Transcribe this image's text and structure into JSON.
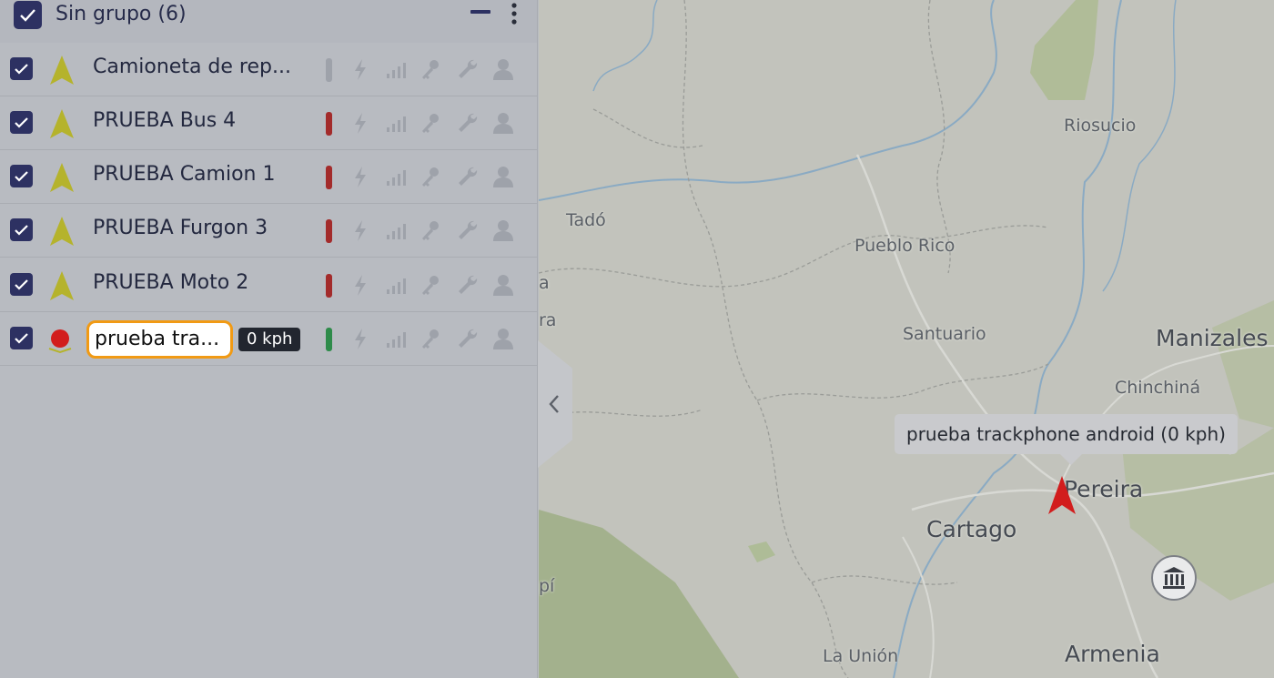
{
  "group": {
    "title": "Sin grupo (6)"
  },
  "devices": [
    {
      "name": "Camioneta de rep...",
      "status_color": "#9ea2aa",
      "marker": "arrow"
    },
    {
      "name": "PRUEBA Bus 4",
      "status_color": "#a32b2b",
      "marker": "arrow"
    },
    {
      "name": "PRUEBA Camion 1",
      "status_color": "#a32b2b",
      "marker": "arrow"
    },
    {
      "name": "PRUEBA Furgon 3",
      "status_color": "#a32b2b",
      "marker": "arrow"
    },
    {
      "name": "PRUEBA Moto 2",
      "status_color": "#a32b2b",
      "marker": "arrow"
    },
    {
      "name": "prueba tra...",
      "speed": "0 kph",
      "status_color": "#2e8b4a",
      "marker": "red-dot"
    }
  ],
  "icons": [
    "bolt-icon",
    "signal-icon",
    "key-icon",
    "wrench-icon",
    "user-icon"
  ],
  "map": {
    "tooltip": "prueba trackphone android (0 kph)",
    "labels": {
      "riosucio": "Riosucio",
      "tado": "Tadó",
      "pueblo_rico": "Pueblo Rico",
      "santuario": "Santuario",
      "manizales": "Manizales",
      "chinchina": "Chinchiná",
      "pereira": "Pereira",
      "cartago": "Cartago",
      "la_union": "La Unión",
      "armenia": "Armenia",
      "edge_a": "a",
      "edge_ra": "ra",
      "edge_pi": "pí"
    }
  },
  "colors": {
    "accent": "#2d3162",
    "highlight": "#f19a14",
    "marker_red": "#d21d1d",
    "arrow_green": "#b5b32c"
  }
}
